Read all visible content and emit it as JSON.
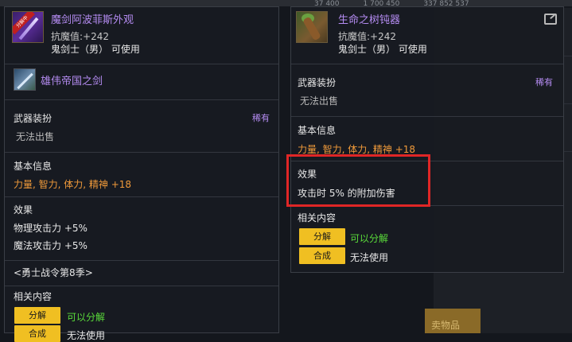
{
  "background": {
    "stats": [
      "37 400",
      "1 700 450",
      "337 852 537"
    ],
    "button_label": "卖物品"
  },
  "left_panel": {
    "item_name": "魔剑阿波菲斯外观",
    "icon_tag": "分解中",
    "resist": "抗魔值:+242",
    "class_req": "鬼剑士（男） 可使用",
    "sub_item_name": "雄伟帝国之剑",
    "category": "武器装扮",
    "rarity": "稀有",
    "trade": "无法出售",
    "basic_info_title": "基本信息",
    "basic_info_stats": "力量, 智力, 体力, 精神 +18",
    "effect_title": "效果",
    "effect_line1": "物理攻击力 +5%",
    "effect_line2": "魔法攻击力 +5%",
    "season": "<勇士战令第8季>",
    "related_title": "相关内容",
    "btn_disassemble": "分解",
    "disassemble_status": "可以分解",
    "btn_synthesize": "合成",
    "synthesize_status": "无法使用"
  },
  "right_panel": {
    "item_name": "生命之树钝器",
    "resist": "抗魔值:+242",
    "class_req": "鬼剑士（男） 可使用",
    "category": "武器装扮",
    "rarity": "稀有",
    "trade": "无法出售",
    "basic_info_title": "基本信息",
    "basic_info_stats": "力量, 智力, 体力, 精神 +18",
    "effect_title": "效果",
    "effect_line1": "攻击时 5% 的附加伤害",
    "related_title": "相关内容",
    "btn_disassemble": "分解",
    "disassemble_status": "可以分解",
    "btn_synthesize": "合成",
    "synthesize_status": "无法使用"
  },
  "colors": {
    "highlight_border": "#e02626",
    "item_name": "#b58cf2",
    "stat_orange": "#f09a3a",
    "status_green": "#5adc3a",
    "button_yellow": "#f0bf22"
  }
}
